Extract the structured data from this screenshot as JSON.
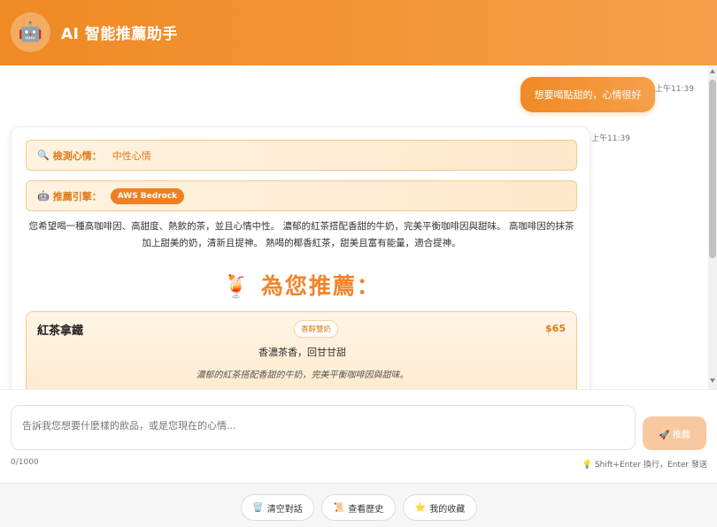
{
  "header": {
    "avatar_icon": "🤖",
    "title": "AI 智能推薦助手"
  },
  "chat": {
    "user_message": {
      "text": "想要喝點甜的，心情很好",
      "time": "上午11:39"
    },
    "bot_message": {
      "time": "上午11:39",
      "mood": {
        "icon": "🔍",
        "label": "檢測心情：",
        "value": "中性心情"
      },
      "engine": {
        "icon": "🤖",
        "label": "推薦引擎：",
        "value": "AWS Bedrock"
      },
      "description": "您希望喝一種高咖啡因、高甜度、熱飲的茶，並且心情中性。 濃郁的紅茶搭配香甜的牛奶，完美平衡咖啡因與甜味。 高咖啡因的抹茶加上甜美的奶，清新且提神。 熱喝的椰香紅茶，甜美且富有能量，適合提神。",
      "rec_heading_icon": "🍹",
      "rec_heading": "為您推薦：",
      "recommendations": [
        {
          "name": "紅茶拿鐵",
          "tag": "香醇雙奶",
          "price": "$65",
          "taste": "香濃茶香，回甘甘甜",
          "reason": "濃郁的紅茶搭配香甜的牛奶，完美平衡咖啡因與甜味。"
        }
      ]
    }
  },
  "input": {
    "placeholder": "告訴我您想要什麼樣的飲品，或是您現在的心情...",
    "value": "",
    "send_label": "🚀 推薦",
    "char_count": "0/1000",
    "hint": "💡 Shift+Enter 換行，Enter 發送"
  },
  "footer": {
    "clear": {
      "icon": "🗑️",
      "label": "清空對話"
    },
    "history": {
      "icon": "📜",
      "label": "查看歷史"
    },
    "favorites": {
      "icon": "⭐",
      "label": "我的收藏"
    }
  },
  "colors": {
    "accent": "#f08a24",
    "accent_light": "#fff3e0",
    "send_disabled": "#f8c9a0"
  }
}
